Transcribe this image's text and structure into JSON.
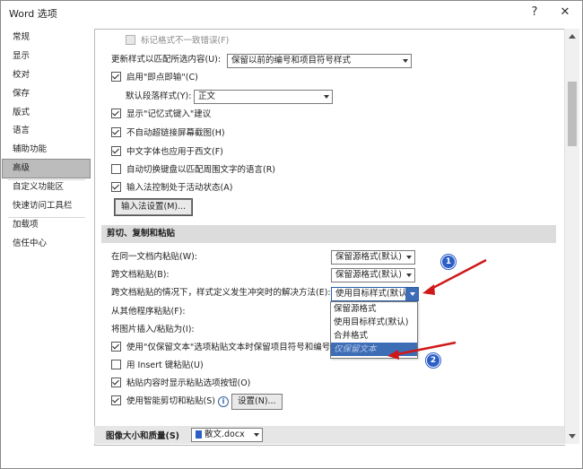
{
  "window": {
    "title": "Word 选项",
    "help_glyph": "?",
    "close_glyph": "✕"
  },
  "sidebar": {
    "items": [
      {
        "label": "常规"
      },
      {
        "label": "显示"
      },
      {
        "label": "校对"
      },
      {
        "label": "保存"
      },
      {
        "label": "版式"
      },
      {
        "label": "语言"
      },
      {
        "label": "辅助功能"
      },
      {
        "label": "高级",
        "selected": true
      },
      {
        "label": "自定义功能区"
      },
      {
        "label": "快速访问工具栏"
      },
      {
        "label": "加载项"
      },
      {
        "label": "信任中心"
      }
    ]
  },
  "editing": {
    "mark_format_inconsistency": {
      "label": "标记格式不一致错误(F)",
      "checked": false,
      "disabled": true
    },
    "update_style_label": "更新样式以匹配所选内容(U):",
    "update_style_value": "保留以前的编号和项目符号样式",
    "click_and_type": {
      "label": "启用\"即点即输\"(C)",
      "checked": true
    },
    "default_para_style_label": "默认段落样式(Y):",
    "default_para_style_value": "正文",
    "autocomplete": {
      "label": "显示\"记忆式键入\"建议",
      "checked": true
    },
    "no_auto_hyperlink": {
      "label": "不自动超链接屏幕截图(H)",
      "checked": true
    },
    "chinese_font_western": {
      "label": "中文字体也应用于西文(F)",
      "checked": true
    },
    "auto_keyboard": {
      "label": "自动切换键盘以匹配周围文字的语言(R)",
      "checked": false
    },
    "ime_active": {
      "label": "输入法控制处于活动状态(A)",
      "checked": true
    },
    "ime_settings_button": "输入法设置(M)..."
  },
  "paste_section": {
    "title": "剪切、复制和粘贴",
    "within_doc_label": "在同一文档内粘贴(W):",
    "within_doc_value": "保留源格式(默认)",
    "between_docs_label": "跨文档粘贴(B):",
    "between_docs_value": "保留源格式(默认)",
    "conflict_label": "跨文档粘贴的情况下，样式定义发生冲突时的解决方法(E):",
    "conflict_value": "使用目标样式(默认)",
    "other_programs_label": "从其他程序粘贴(F):",
    "insert_picture_label": "将图片插入/粘贴为(I):",
    "keep_bullets": {
      "label": "使用\"仅保留文本\"选项粘贴文本时保留项目符号和编号",
      "checked": true
    },
    "insert_key": {
      "label": "用 Insert 键粘贴(U)",
      "checked": false
    },
    "show_paste_options": {
      "label": "粘贴内容时显示粘贴选项按钮(O)",
      "checked": true
    },
    "smart_cut": {
      "label": "使用智能剪切和粘贴(S)",
      "checked": true
    },
    "info_glyph": "i",
    "settings_button": "设置(N)..."
  },
  "dropdown_options": [
    {
      "label": "保留源格式"
    },
    {
      "label": "使用目标样式(默认)"
    },
    {
      "label": "合并格式"
    },
    {
      "label": "仅保留文本",
      "highlighted": true
    }
  ],
  "image_section": {
    "title": "图像大小和质量(S)",
    "doc_value": "散文.docx"
  },
  "annotations": [
    {
      "label": "1"
    },
    {
      "label": "2"
    }
  ],
  "colors": {
    "accent": "#3d6db5",
    "annotation": "#2b5fc6",
    "arrow": "#d01818",
    "selected_sidebar": "#bcbcbc"
  }
}
